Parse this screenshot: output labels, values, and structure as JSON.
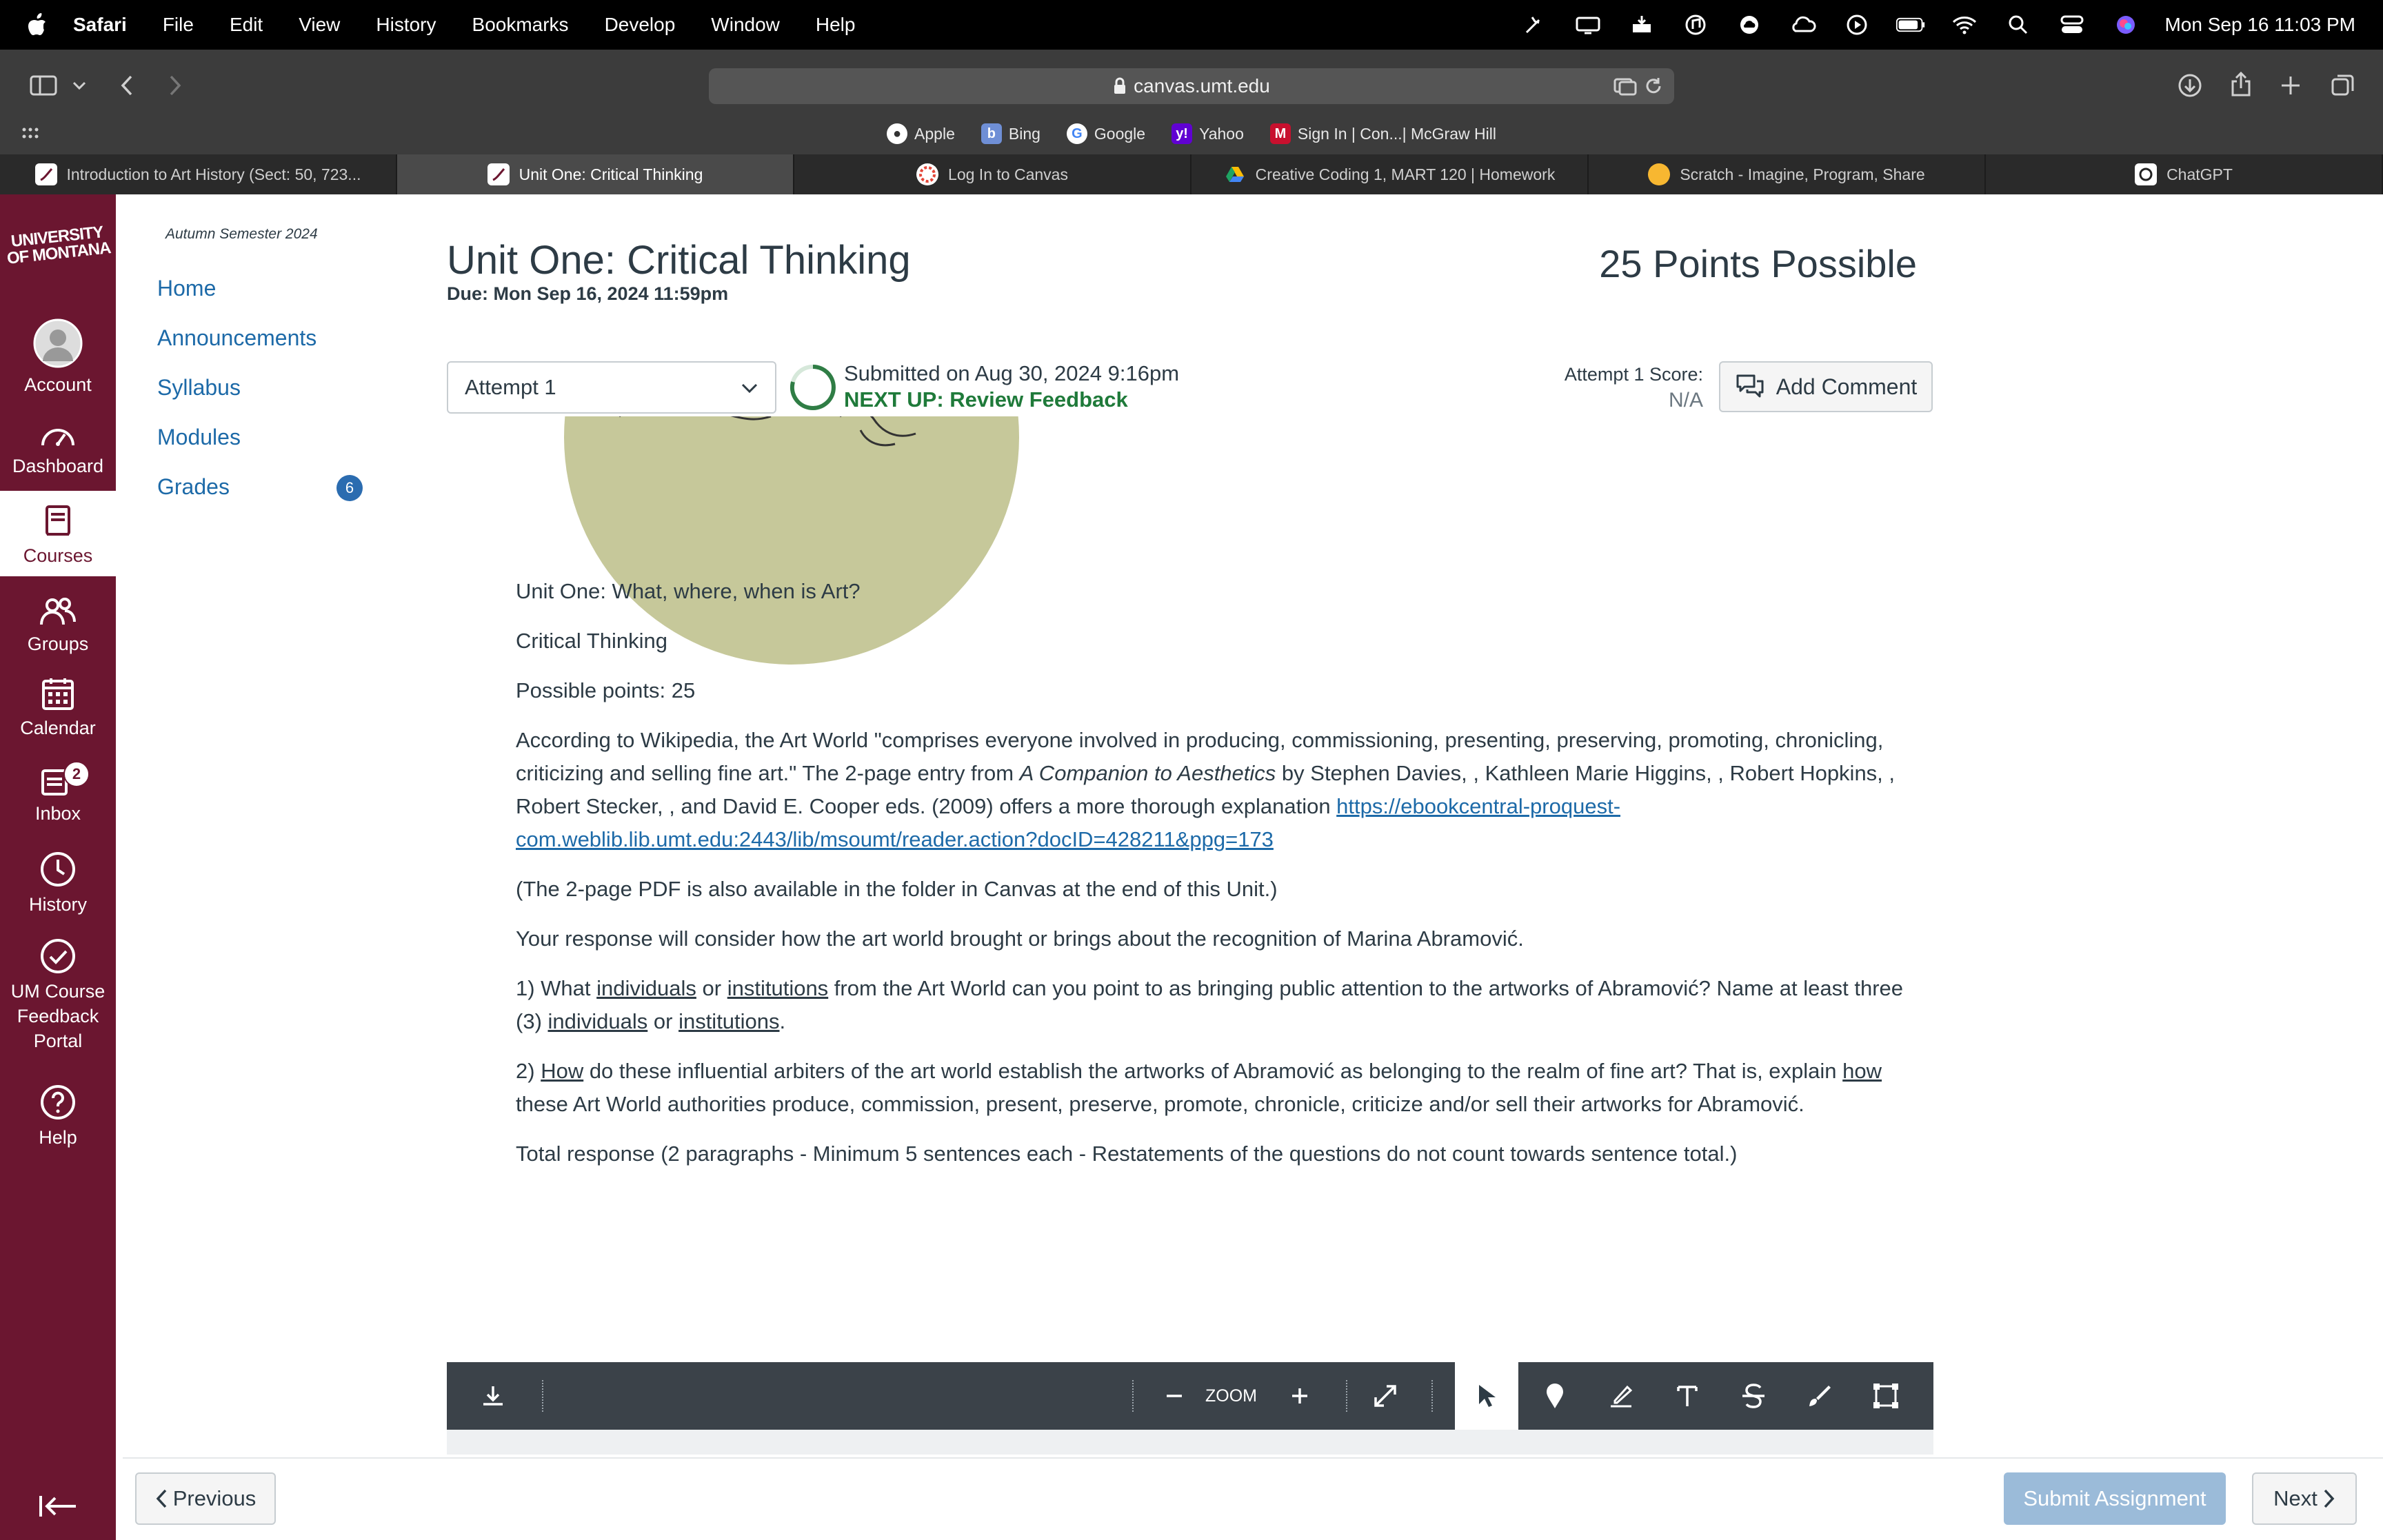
{
  "menubar": {
    "app": "Safari",
    "items": [
      "File",
      "Edit",
      "View",
      "History",
      "Bookmarks",
      "Develop",
      "Window",
      "Help"
    ],
    "clock": "Mon Sep 16  11:03 PM"
  },
  "browser": {
    "url": "canvas.umt.edu",
    "bookmarks": [
      "Apple",
      "Bing",
      "Google",
      "Yahoo",
      "Sign In | Con...| McGraw Hill"
    ],
    "tabs": [
      "Introduction to Art History (Sect: 50, 723...",
      "Unit One: Critical Thinking",
      "Log In to Canvas",
      "Creative Coding 1, MART 120 | Homework",
      "Scratch - Imagine, Program, Share",
      "ChatGPT"
    ]
  },
  "global_nav": {
    "logo_line1": "UNIVERSITY",
    "logo_line2": "OF MONTANA",
    "items": [
      "Account",
      "Dashboard",
      "Courses",
      "Groups",
      "Calendar",
      "Inbox",
      "History",
      "UM Course Feedback Portal",
      "Help"
    ],
    "inbox_badge": "2"
  },
  "course_nav": {
    "term": "Autumn Semester 2024",
    "links": [
      "Home",
      "Announcements",
      "Syllabus",
      "Modules",
      "Grades"
    ],
    "grades_badge": "6"
  },
  "assignment": {
    "title": "Unit One: Critical Thinking",
    "due": "Due: Mon Sep 16, 2024 11:59pm",
    "points": "25 Points Possible",
    "attempt": "Attempt 1",
    "submitted": "Submitted on Aug 30, 2024 9:16pm",
    "next_up": "NEXT UP: Review Feedback",
    "score_label": "Attempt 1 Score:",
    "score_value": "N/A",
    "add_comment": "Add Comment"
  },
  "document": {
    "p1": "Unit One: What, where, when is Art?",
    "p2": "Critical Thinking",
    "p3": "Possible points: 25",
    "p4a": "According to Wikipedia, the Art World \"comprises everyone involved in producing, commissioning, presenting, preserving, promoting, chronicling, criticizing and selling fine art.\" The 2-page entry from ",
    "p4_book": "A Companion to Aesthetics",
    "p4b": " by Stephen Davies, , Kathleen Marie Higgins, , Robert Hopkins, , Robert Stecker, , and David E. Cooper eds. (2009) offers a more thorough explanation ",
    "p4_link": "https://ebookcentral-proquest-com.weblib.lib.umt.edu:2443/lib/msoumt/reader.action?docID=428211&ppg=173",
    "p5": "(The 2-page PDF is also available in the folder in Canvas at the end of this Unit.)",
    "p6": "Your response will consider how the art world brought or brings about the recognition of Marina Abramović.",
    "q1_a": "1) What ",
    "q1_w1": "individuals",
    "q1_b": " or ",
    "q1_w2": "institutions",
    "q1_c": " from the Art World can you point to as bringing public attention to the artworks of Abramović? Name at least three (3) ",
    "q1_w3": "individuals",
    "q1_d": " or ",
    "q1_w4": "institutions",
    "q1_e": ".",
    "q2_a": "2) ",
    "q2_w1": "How",
    "q2_b": " do these influential arbiters of the art world establish the artworks of Abramović as belonging to the realm of fine art?  That is, explain ",
    "q2_w2": "how ",
    "q2_c": "these Art World authorities produce, commission, present, preserve, promote, chronicle, criticize and/or sell their artworks for Abramović.",
    "p7": "Total response (2 paragraphs - Minimum 5 sentences each - Restatements of the questions do not count towards sentence total.)"
  },
  "annot_toolbar": {
    "zoom_label": "ZOOM"
  },
  "footer": {
    "previous": "Previous",
    "submit": "Submit Assignment",
    "next": "Next"
  }
}
